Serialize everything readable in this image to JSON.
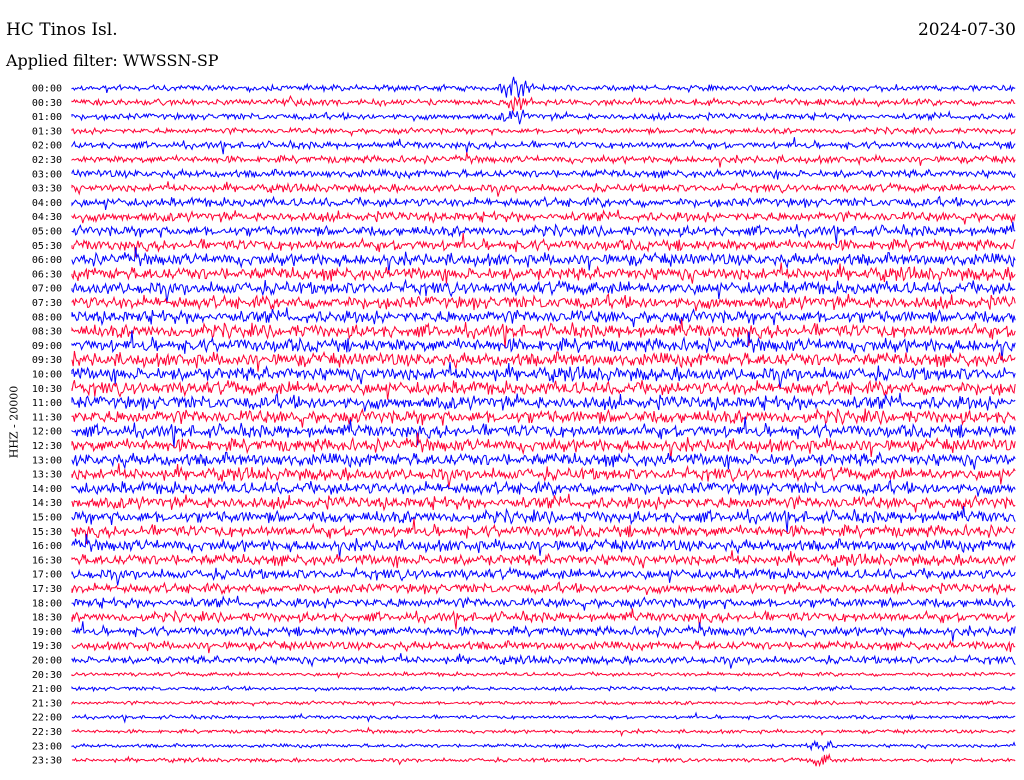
{
  "header": {
    "station": "HC Tinos Isl.",
    "filter": "Applied filter: WWSSN-SP",
    "date": "2024-07-30"
  },
  "chart_data": {
    "type": "line",
    "title": "HC Tinos Isl.",
    "subtitle": "Applied filter: WWSSN-SP",
    "date": "2024-07-30",
    "ylabel": "HHZ - 20000",
    "xlabel": "",
    "row_labels": [
      "00:00",
      "00:30",
      "01:00",
      "01:30",
      "02:00",
      "02:30",
      "03:00",
      "03:30",
      "04:00",
      "04:30",
      "05:00",
      "05:30",
      "06:00",
      "06:30",
      "07:00",
      "07:30",
      "08:00",
      "08:30",
      "09:00",
      "09:30",
      "10:00",
      "10:30",
      "11:00",
      "11:30",
      "12:00",
      "12:30",
      "13:00",
      "13:30",
      "14:00",
      "14:30",
      "15:00",
      "15:30",
      "16:00",
      "16:30",
      "17:00",
      "17:30",
      "18:00",
      "18:30",
      "19:00",
      "19:30",
      "20:00",
      "20:30",
      "21:00",
      "21:30",
      "22:00",
      "22:30",
      "23:00",
      "23:30"
    ],
    "row_amplitude": [
      0.45,
      0.5,
      0.5,
      0.45,
      0.55,
      0.55,
      0.6,
      0.6,
      0.7,
      0.75,
      0.8,
      0.85,
      0.95,
      1.0,
      1.0,
      1.0,
      1.0,
      1.05,
      1.05,
      1.05,
      1.05,
      1.05,
      1.05,
      1.05,
      1.0,
      1.0,
      1.0,
      0.95,
      0.95,
      0.95,
      0.95,
      0.9,
      0.9,
      0.85,
      0.8,
      0.75,
      0.75,
      0.75,
      0.7,
      0.65,
      0.6,
      0.3,
      0.3,
      0.28,
      0.28,
      0.28,
      0.28,
      0.3
    ],
    "events": [
      {
        "row": 0,
        "x_fraction": 0.47,
        "amplitude": 5.0
      },
      {
        "row": 1,
        "x_fraction": 0.47,
        "amplitude": 2.5
      },
      {
        "row": 2,
        "x_fraction": 0.47,
        "amplitude": 1.8
      },
      {
        "row": 46,
        "x_fraction": 0.795,
        "amplitude": 2.5
      },
      {
        "row": 47,
        "x_fraction": 0.795,
        "amplitude": 3.0
      }
    ],
    "colors": [
      "#0000ff",
      "#ff0033"
    ],
    "grid": false
  }
}
